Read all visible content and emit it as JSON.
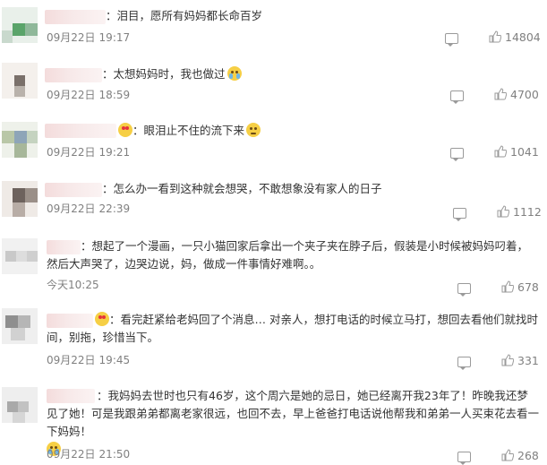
{
  "comments": [
    {
      "text": "：泪目，愿所有妈妈都长命百岁",
      "date": "09月22日",
      "time": "19:17",
      "likes": "14804",
      "emoji": ""
    },
    {
      "text": "：太想妈妈时，我也做过",
      "date": "09月22日",
      "time": "18:59",
      "likes": "4700",
      "emoji": "cry"
    },
    {
      "text": "：眼泪止不住的流下来",
      "date": "09月22日",
      "time": "19:21",
      "likes": "1041",
      "emoji": "sad"
    },
    {
      "text": "：怎么办一看到这种就会想哭，不敢想象没有家人的日子",
      "date": "09月22日",
      "time": "22:39",
      "likes": "1112",
      "emoji": ""
    },
    {
      "text": "：想起了一个漫画，一只小猫回家后拿出一个夹子夹在脖子后，假装是小时候被妈妈叼着，然后大声哭了，边哭边说，妈，做成一件事情好难啊。。",
      "date": "今天",
      "time": "10:25",
      "likes": "678",
      "emoji": ""
    },
    {
      "text": "：看完赶紧给老妈回了个消息… 对亲人，想打电话的时候立马打，想回去看他们就找时间，别拖，珍惜当下。",
      "date": "09月22日",
      "time": "19:45",
      "likes": "331",
      "emoji": ""
    },
    {
      "text": "：我妈妈去世时也只有46岁，这个周六是她的忌日，她已经离开我23年了！昨晚我还梦见了她！可是我跟弟弟都离老家很远，也回不去，早上爸爸打电话说他帮我和弟弟一人买束花去看一下妈妈！",
      "date": "09月22日",
      "time": "21:50",
      "likes": "268",
      "emoji": "cry"
    }
  ],
  "colors": {
    "text": "#333333",
    "meta": "#808080",
    "icon": "#9a9a9a"
  },
  "icons": {
    "comment": "comment-icon",
    "like": "thumbs-up-icon",
    "emoji_cry": "crying-face-icon",
    "emoji_sad": "pleading-face-icon",
    "emoji_heart": "heart-eyes-icon"
  }
}
